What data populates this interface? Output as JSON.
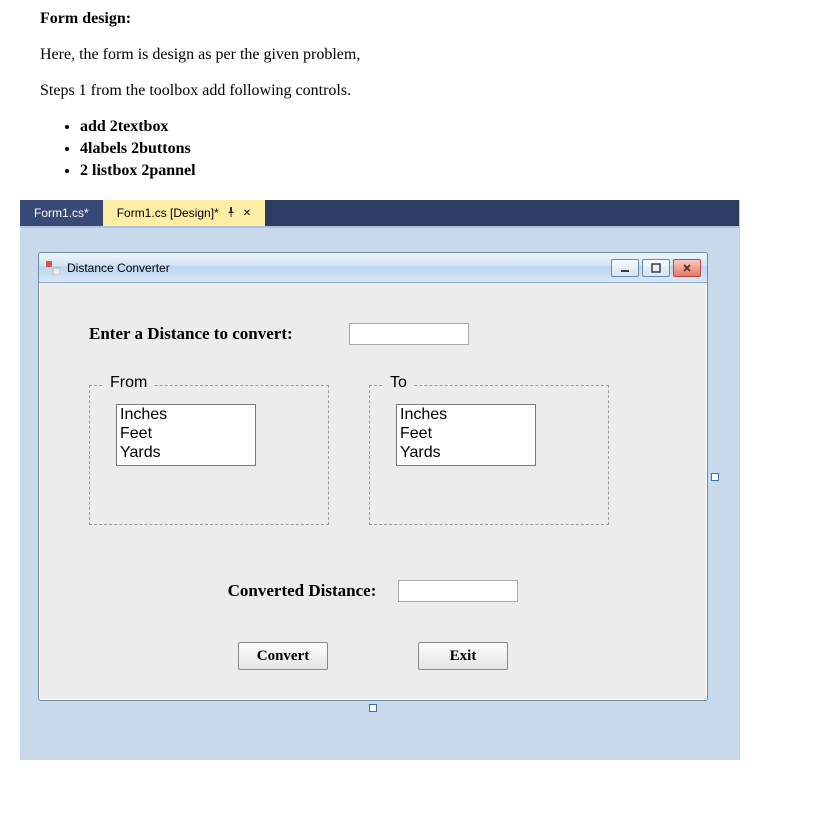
{
  "doc": {
    "heading": "Form design:",
    "para1": "Here, the form is design as per the given problem,",
    "para2": "Steps 1 from the toolbox add following controls.",
    "bullets": [
      "add 2textbox",
      "4labels 2buttons",
      "2 listbox 2pannel"
    ]
  },
  "ide": {
    "tabs": {
      "inactive": "Form1.cs*",
      "active": "Form1.cs [Design]*"
    }
  },
  "form": {
    "title": "Distance Converter",
    "enter_label": "Enter a Distance to convert:",
    "from_title": "From",
    "to_title": "To",
    "list_items": [
      "Inches",
      "Feet",
      "Yards"
    ],
    "converted_label": "Converted Distance:",
    "convert_btn": "Convert",
    "exit_btn": "Exit",
    "distance_value": "",
    "converted_value": ""
  }
}
